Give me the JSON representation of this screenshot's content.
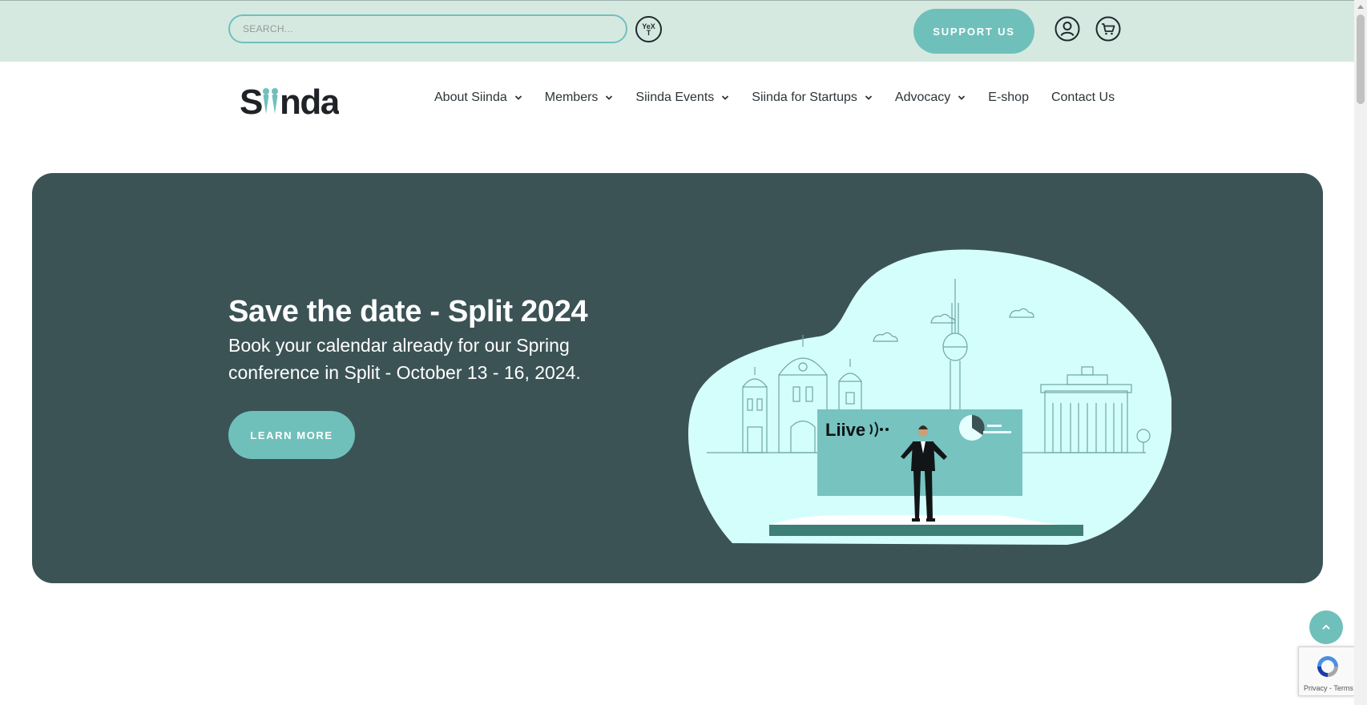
{
  "topbar": {
    "search_placeholder": "SEARCH...",
    "yext_label": "YeXT",
    "support_label": "SUPPORT US"
  },
  "header": {
    "logo_text": "Siinda",
    "nav": [
      {
        "label": "About Siinda",
        "has_dropdown": true
      },
      {
        "label": "Members",
        "has_dropdown": true
      },
      {
        "label": "Siinda Events",
        "has_dropdown": true
      },
      {
        "label": "Siinda for Startups",
        "has_dropdown": true
      },
      {
        "label": "Advocacy",
        "has_dropdown": true
      },
      {
        "label": "E-shop",
        "has_dropdown": false
      },
      {
        "label": "Contact Us",
        "has_dropdown": false
      }
    ]
  },
  "hero": {
    "title": "Save the date - Split 2024",
    "text": "Book your calendar already for our Spring conference in Split - October 13 - 16, 2024.",
    "button_label": "LEARN MORE",
    "illustration": {
      "screen_label": "Liive"
    }
  },
  "recaptcha": {
    "links": "Privacy - Terms"
  },
  "colors": {
    "accent": "#6fc0bb",
    "topbar_bg": "#d6e9e1",
    "hero_bg": "#3c5355",
    "blob": "#d4fefc",
    "text_dark": "#1f2a2e"
  },
  "icons": [
    "yext-icon",
    "user-icon",
    "cart-icon",
    "chevron-down-icon",
    "chevron-up-icon",
    "recaptcha-icon"
  ]
}
